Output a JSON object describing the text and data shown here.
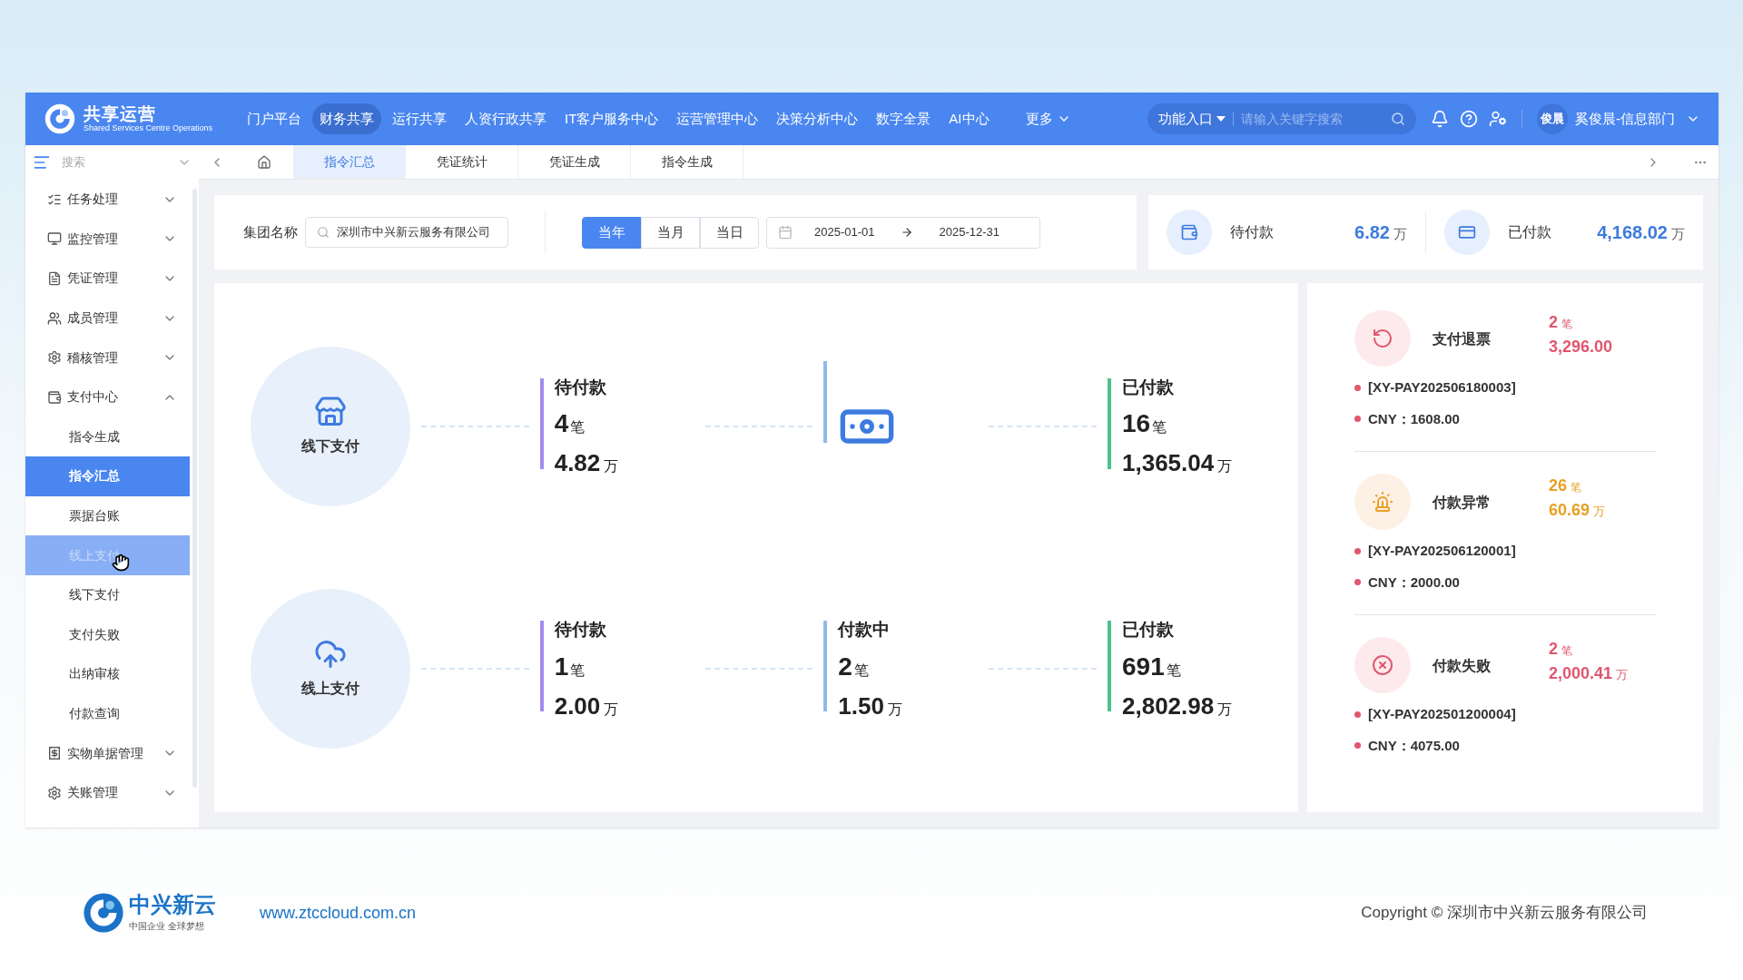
{
  "header": {
    "logo_title": "共享运营",
    "logo_subtitle": "Shared Services Centre Operations",
    "nav": [
      {
        "label": "门户平台",
        "selected": false
      },
      {
        "label": "财务共享",
        "selected": true
      },
      {
        "label": "运行共享",
        "selected": false
      },
      {
        "label": "人资行政共享",
        "selected": false
      },
      {
        "label": "IT客户服务中心",
        "selected": false
      },
      {
        "label": "运营管理中心",
        "selected": false
      },
      {
        "label": "决策分析中心",
        "selected": false
      },
      {
        "label": "数字全景",
        "selected": false
      },
      {
        "label": "AI中心",
        "selected": false
      },
      {
        "label": "更多",
        "selected": false
      }
    ],
    "function_entry": "功能入口",
    "search_placeholder": "请输入关键字搜索",
    "avatar": "俊晨",
    "user": "奚俊晨-信息部门"
  },
  "sidebar": {
    "search_placeholder": "搜索",
    "items": [
      {
        "label": "任务处理",
        "expanded": false
      },
      {
        "label": "监控管理",
        "expanded": false
      },
      {
        "label": "凭证管理",
        "expanded": false
      },
      {
        "label": "成员管理",
        "expanded": false
      },
      {
        "label": "稽核管理",
        "expanded": false
      },
      {
        "label": "支付中心",
        "expanded": true,
        "children": [
          {
            "label": "指令生成",
            "selected": false,
            "hovered": false
          },
          {
            "label": "指令汇总",
            "selected": true,
            "hovered": false
          },
          {
            "label": "票据台账",
            "selected": false,
            "hovered": false
          },
          {
            "label": "线上支付",
            "selected": false,
            "hovered": true
          },
          {
            "label": "线下支付",
            "selected": false,
            "hovered": false
          },
          {
            "label": "支付失败",
            "selected": false,
            "hovered": false
          },
          {
            "label": "出纳审核",
            "selected": false,
            "hovered": false
          },
          {
            "label": "付款查询",
            "selected": false,
            "hovered": false
          }
        ]
      },
      {
        "label": "实物单据管理",
        "expanded": false
      },
      {
        "label": "关账管理",
        "expanded": false
      }
    ]
  },
  "tabs": [
    {
      "label": "指令汇总",
      "selected": true
    },
    {
      "label": "凭证统计",
      "selected": false
    },
    {
      "label": "凭证生成",
      "selected": false
    },
    {
      "label": "指令生成",
      "selected": false
    }
  ],
  "filter": {
    "label": "集团名称",
    "company": "深圳市中兴新云服务有限公司",
    "periods": [
      {
        "label": "当年",
        "selected": true
      },
      {
        "label": "当月",
        "selected": false
      },
      {
        "label": "当日",
        "selected": false
      }
    ],
    "date_from": "2025-01-01",
    "date_to": "2025-12-31"
  },
  "summary": [
    {
      "label": "待付款",
      "value": "6.82",
      "unit": "万"
    },
    {
      "label": "已付款",
      "value": "4,168.02",
      "unit": "万"
    }
  ],
  "flows": [
    {
      "title": "线下支付",
      "stages": [
        {
          "kind": "stage",
          "label": "待付款",
          "color": "#a48cf0",
          "count": "4",
          "count_unit": "笔",
          "amount": "4.82",
          "amount_unit": "万"
        },
        {
          "kind": "icon"
        },
        {
          "kind": "stage",
          "label": "已付款",
          "color": "#4cc38a",
          "count": "16",
          "count_unit": "笔",
          "amount": "1,365.04",
          "amount_unit": "万"
        }
      ]
    },
    {
      "title": "线上支付",
      "stages": [
        {
          "kind": "stage",
          "label": "待付款",
          "color": "#a48cf0",
          "count": "1",
          "count_unit": "笔",
          "amount": "2.00",
          "amount_unit": "万"
        },
        {
          "kind": "stage",
          "label": "付款中",
          "color": "#8fb8ee",
          "count": "2",
          "count_unit": "笔",
          "amount": "1.50",
          "amount_unit": "万"
        },
        {
          "kind": "stage",
          "label": "已付款",
          "color": "#4cc38a",
          "count": "691",
          "count_unit": "笔",
          "amount": "2,802.98",
          "amount_unit": "万"
        }
      ]
    }
  ],
  "alerts": [
    {
      "label": "支付退票",
      "color": "#e0566e",
      "count": "2",
      "count_unit": "笔",
      "amount": "3,296.00",
      "code": "[XY-PAY202506180003]",
      "cny": "CNY：1608.00"
    },
    {
      "label": "付款异常",
      "color": "#e8a024",
      "count": "26",
      "count_unit": "笔",
      "amount": "60.69",
      "amount_unit": "万",
      "code": "[XY-PAY202506120001]",
      "cny": "CNY：2000.00"
    },
    {
      "label": "付款失败",
      "color": "#e0566e",
      "count": "2",
      "count_unit": "笔",
      "amount": "2,000.41",
      "amount_unit": "万",
      "code": "[XY-PAY202501200004]",
      "cny": "CNY：4075.00"
    }
  ],
  "footer": {
    "brand": "中兴新云",
    "slogan": "中国企业 全球梦想",
    "url": "www.ztccloud.com.cn",
    "copyright": "Copyright © 深圳市中兴新云服务有限公司"
  }
}
